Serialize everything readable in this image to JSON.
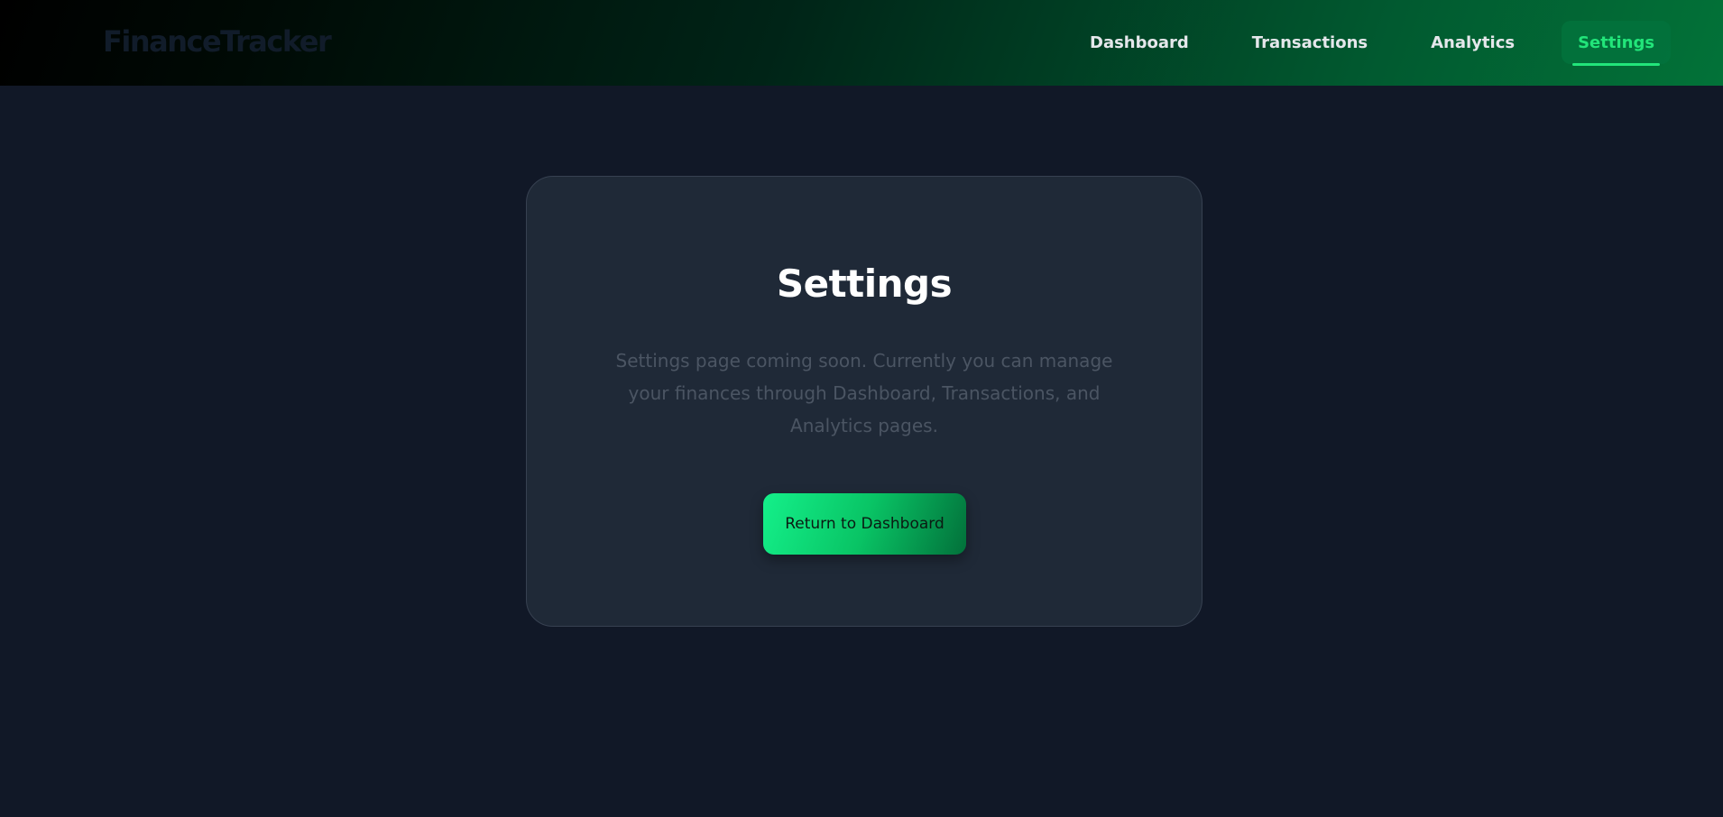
{
  "app": {
    "brand": "FinanceTracker"
  },
  "nav": {
    "items": [
      {
        "label": "Dashboard",
        "active": false
      },
      {
        "label": "Transactions",
        "active": false
      },
      {
        "label": "Analytics",
        "active": false
      },
      {
        "label": "Settings",
        "active": true
      }
    ]
  },
  "main": {
    "title": "Settings",
    "message": "Settings page coming soon. Currently you can manage your finances through Dashboard, Transactions, and Analytics pages.",
    "button_label": "Return to Dashboard"
  },
  "colors": {
    "accent": "#22e57a",
    "background": "#111827",
    "card": "#1f2937",
    "muted_text": "#4b5563"
  }
}
